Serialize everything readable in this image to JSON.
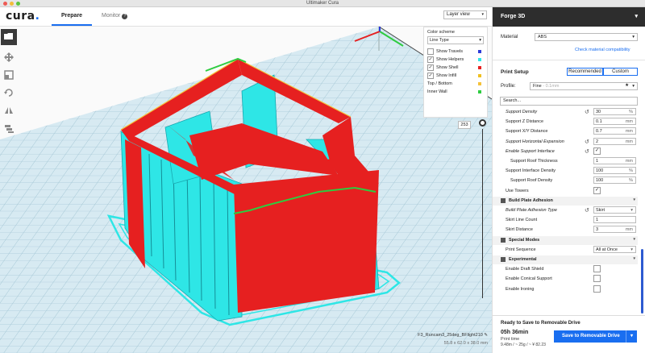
{
  "window": {
    "title": "Ultimaker Cura"
  },
  "header": {
    "logo_text": "cura",
    "logo_dot": ".",
    "tabs": [
      {
        "label": "Prepare"
      },
      {
        "label": "Monitor"
      }
    ],
    "view_select": "Layer view"
  },
  "color_scheme": {
    "title": "Color scheme",
    "mode": "Line Type",
    "toggles": [
      {
        "label": "Show Travels",
        "checked": false,
        "color": "#2d3bd9"
      },
      {
        "label": "Show Helpers",
        "checked": true,
        "color": "#2ee6e6"
      },
      {
        "label": "Show Shell",
        "checked": true,
        "color": "#e62020"
      },
      {
        "label": "Show Infill",
        "checked": true,
        "color": "#f0c020"
      }
    ],
    "lines": [
      {
        "label": "Top / Bottom",
        "color": "#f5c23a"
      },
      {
        "label": "Inner Wall",
        "color": "#2ecc40"
      }
    ]
  },
  "layer": {
    "current": "253"
  },
  "model": {
    "filename": "F3_Runcam3_25deg_BFlight210",
    "dimensions": "55.8 x 62.0 x 38.0 mm"
  },
  "sidebar": {
    "printer": "Forge 3D",
    "material_label": "Material",
    "material_value": "ABS",
    "compat_link": "Check material compatibility",
    "print_setup": "Print Setup",
    "mode_recommended": "Recommended",
    "mode_custom": "Custom",
    "profile_label": "Profile:",
    "profile_value": "Fine",
    "profile_hint": "- 0.1mm",
    "search_placeholder": "Search...",
    "settings": [
      {
        "type": "value",
        "name": "Support Density",
        "italic": true,
        "reset": true,
        "value": "30",
        "unit": "%"
      },
      {
        "type": "value",
        "name": "Support Z Distance",
        "italic": false,
        "reset": false,
        "value": "0.1",
        "unit": "mm"
      },
      {
        "type": "value",
        "name": "Support X/Y Distance",
        "italic": false,
        "reset": false,
        "value": "0.7",
        "unit": "mm"
      },
      {
        "type": "value",
        "name": "Support Horizontal Expansion",
        "italic": true,
        "reset": true,
        "value": "2",
        "unit": "mm"
      },
      {
        "type": "check",
        "name": "Enable Support Interface",
        "italic": true,
        "reset": true,
        "checked": true
      },
      {
        "type": "value",
        "name": "Support Roof Thickness",
        "indent": true,
        "italic": false,
        "reset": false,
        "value": "1",
        "unit": "mm"
      },
      {
        "type": "value",
        "name": "Support Interface Density",
        "italic": false,
        "reset": false,
        "value": "100",
        "unit": "%"
      },
      {
        "type": "value",
        "name": "Support Roof Density",
        "indent": true,
        "italic": false,
        "reset": false,
        "value": "100",
        "unit": "%"
      },
      {
        "type": "check",
        "name": "Use Towers",
        "italic": false,
        "reset": false,
        "checked": true
      },
      {
        "type": "category",
        "name": "Build Plate Adhesion"
      },
      {
        "type": "select",
        "name": "Build Plate Adhesion Type",
        "italic": true,
        "reset": true,
        "value": "Skirt"
      },
      {
        "type": "value",
        "name": "Skirt Line Count",
        "italic": false,
        "reset": false,
        "value": "1",
        "unit": ""
      },
      {
        "type": "value",
        "name": "Skirt Distance",
        "italic": false,
        "reset": false,
        "value": "3",
        "unit": "mm"
      },
      {
        "type": "category",
        "name": "Special Modes"
      },
      {
        "type": "select",
        "name": "Print Sequence",
        "italic": false,
        "reset": false,
        "value": "All at Once"
      },
      {
        "type": "category",
        "name": "Experimental"
      },
      {
        "type": "check",
        "name": "Enable Draft Shield",
        "italic": false,
        "reset": false,
        "checked": false
      },
      {
        "type": "check",
        "name": "Enable Conical Support",
        "italic": false,
        "reset": false,
        "checked": false
      },
      {
        "type": "check",
        "name": "Enable Ironing",
        "italic": false,
        "reset": false,
        "checked": false
      }
    ],
    "ready": "Ready to Save to Removable Drive",
    "print_time": "05h 36min",
    "print_time_label": "Print time",
    "material_usage": "9.48m / ~ 25g / ~ ¥ 82.23",
    "save_button": "Save to Removable Drive"
  },
  "colors": {
    "accent": "#196ef0",
    "shell": "#e62020",
    "support": "#2ee6e6",
    "inner_wall": "#2ecc40",
    "grid_bg": "#cde5ee"
  }
}
